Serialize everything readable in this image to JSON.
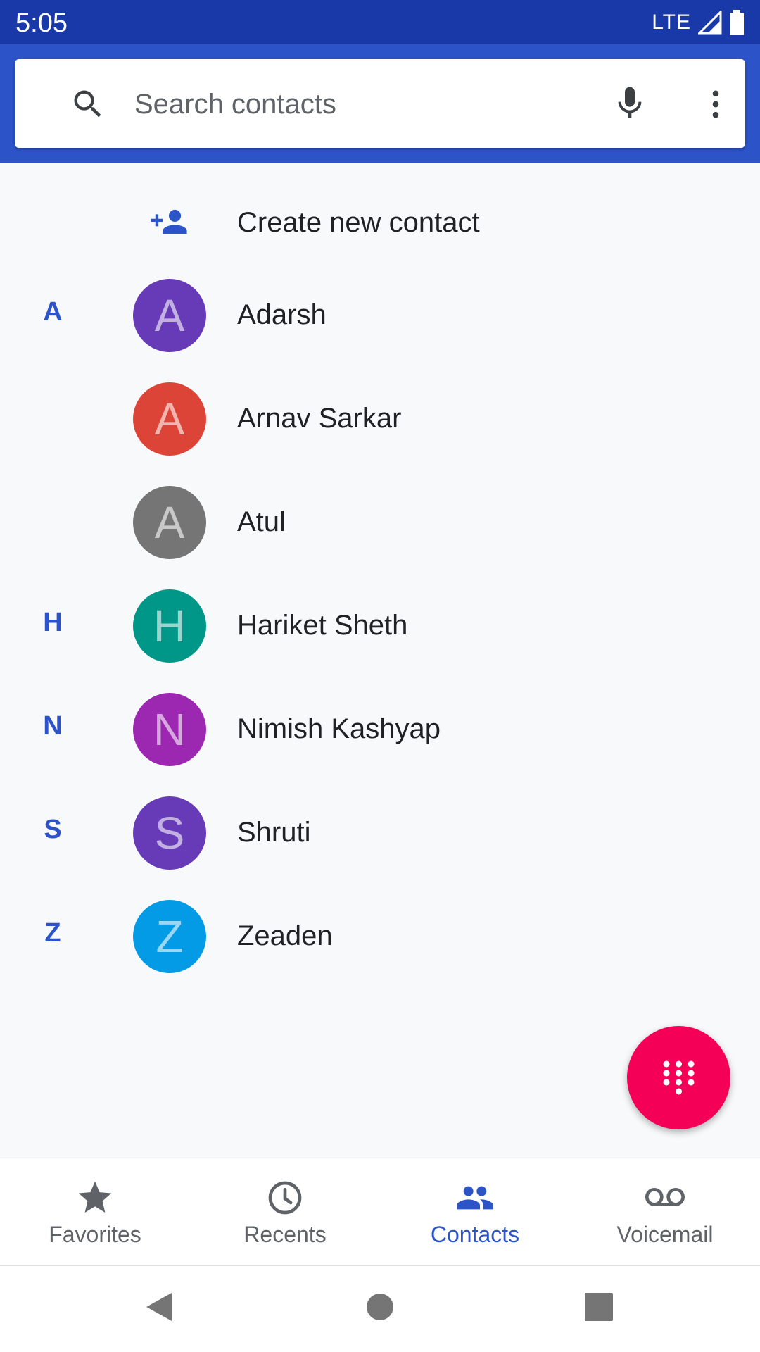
{
  "status_bar": {
    "time": "5:05",
    "network": "LTE"
  },
  "search": {
    "placeholder": "Search contacts"
  },
  "create_contact": {
    "label": "Create new contact"
  },
  "contacts": [
    {
      "section": "A",
      "initial": "A",
      "name": "Adarsh",
      "color": "#673ab7"
    },
    {
      "section": "",
      "initial": "A",
      "name": "Arnav Sarkar",
      "color": "#db4437"
    },
    {
      "section": "",
      "initial": "A",
      "name": "Atul",
      "color": "#757575"
    },
    {
      "section": "H",
      "initial": "H",
      "name": "Hariket Sheth",
      "color": "#009688"
    },
    {
      "section": "N",
      "initial": "N",
      "name": "Nimish Kashyap",
      "color": "#9c27b0"
    },
    {
      "section": "S",
      "initial": "S",
      "name": "Shruti",
      "color": "#673ab7"
    },
    {
      "section": "Z",
      "initial": "Z",
      "name": "Zeaden",
      "color": "#039be5"
    }
  ],
  "fab": {
    "icon": "dialpad-icon",
    "color": "#f50057"
  },
  "bottom_nav": {
    "active": "Contacts",
    "items": [
      {
        "label": "Favorites",
        "icon": "star-icon"
      },
      {
        "label": "Recents",
        "icon": "clock-icon"
      },
      {
        "label": "Contacts",
        "icon": "people-icon"
      },
      {
        "label": "Voicemail",
        "icon": "voicemail-icon"
      }
    ]
  },
  "colors": {
    "status_bar": "#1a39a8",
    "app_bar": "#2c54c8",
    "accent": "#2c54c8"
  }
}
